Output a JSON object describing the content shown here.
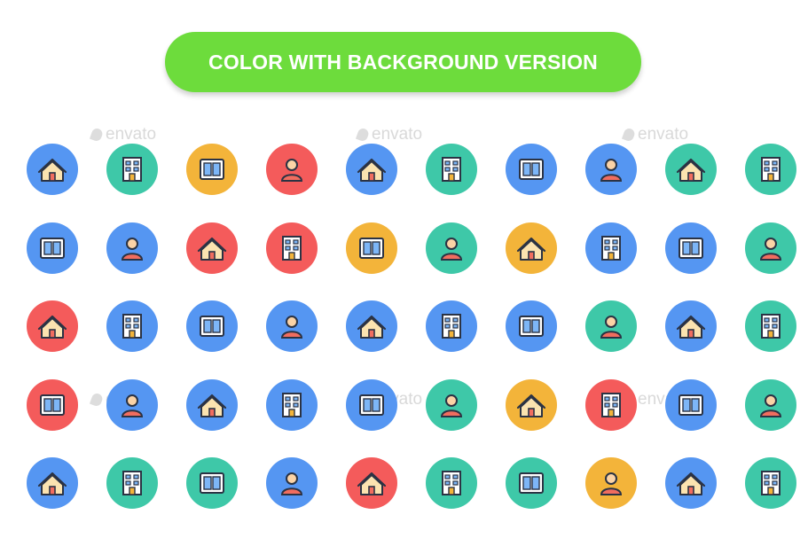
{
  "banner": {
    "text": "COLOR WITH BACKGROUND VERSION",
    "color": "#6ddc3c"
  },
  "watermark": {
    "text": "envato"
  },
  "colors": {
    "blue": "#5596f2",
    "teal": "#3ec8a8",
    "orange": "#f3b43a",
    "red": "#f45b5b"
  },
  "icons": [
    [
      {
        "name": "swimming-pool-icon",
        "bg": "blue"
      },
      {
        "name": "window-icon",
        "bg": "teal"
      },
      {
        "name": "elevator-icon",
        "bg": "orange"
      },
      {
        "name": "lift-people-icon",
        "bg": "red"
      },
      {
        "name": "apartment-building-icon",
        "bg": "blue"
      },
      {
        "name": "house-repair-icon",
        "bg": "teal"
      },
      {
        "name": "house-keys-icon",
        "bg": "blue"
      },
      {
        "name": "mosque-icon",
        "bg": "blue"
      },
      {
        "name": "real-estate-agent-icon",
        "bg": "teal"
      },
      {
        "name": "house-tools-icon",
        "bg": "teal"
      }
    ],
    [
      {
        "name": "store-icon",
        "bg": "blue"
      },
      {
        "name": "waterfront-house-icon",
        "bg": "blue"
      },
      {
        "name": "cottage-icon",
        "bg": "red"
      },
      {
        "name": "property-discount-icon",
        "bg": "red"
      },
      {
        "name": "bathtub-shower-icon",
        "bg": "orange"
      },
      {
        "name": "construction-worker-icon",
        "bg": "teal"
      },
      {
        "name": "property-contract-icon",
        "bg": "orange"
      },
      {
        "name": "bath-relax-icon",
        "bg": "blue"
      },
      {
        "name": "government-building-icon",
        "bg": "blue"
      },
      {
        "name": "skyscraper-icon",
        "bg": "teal"
      }
    ],
    [
      {
        "name": "office-tower-icon",
        "bg": "red"
      },
      {
        "name": "house-money-icon",
        "bg": "blue"
      },
      {
        "name": "villa-icon",
        "bg": "blue"
      },
      {
        "name": "robotic-arm-icon",
        "bg": "blue"
      },
      {
        "name": "city-buildings-icon",
        "bg": "blue"
      },
      {
        "name": "home-outdoor-icon",
        "bg": "blue"
      },
      {
        "name": "homeowner-icon",
        "bg": "blue"
      },
      {
        "name": "apartment-block-icon",
        "bg": "teal"
      },
      {
        "name": "hotel-icon",
        "bg": "blue"
      },
      {
        "name": "family-house-icon",
        "bg": "teal"
      }
    ],
    [
      {
        "name": "mortgage-document-icon",
        "bg": "red"
      },
      {
        "name": "house-tree-icon",
        "bg": "blue"
      },
      {
        "name": "bank-icon",
        "bg": "blue"
      },
      {
        "name": "family-home-icon",
        "bg": "blue"
      },
      {
        "name": "neighborhood-icon",
        "bg": "blue"
      },
      {
        "name": "toolbox-icon",
        "bg": "teal"
      },
      {
        "name": "resident-icon",
        "bg": "orange"
      },
      {
        "name": "house-coins-icon",
        "bg": "red"
      },
      {
        "name": "home-person-icon",
        "bg": "blue"
      },
      {
        "name": "farm-barn-icon",
        "bg": "teal"
      }
    ],
    [
      {
        "name": "suburban-house-icon",
        "bg": "blue"
      },
      {
        "name": "church-icon",
        "bg": "teal"
      },
      {
        "name": "factory-icon",
        "bg": "teal"
      },
      {
        "name": "house-heating-icon",
        "bg": "blue"
      },
      {
        "name": "online-property-icon",
        "bg": "red"
      },
      {
        "name": "wheelbarrow-icon",
        "bg": "teal"
      },
      {
        "name": "property-presentation-icon",
        "bg": "teal"
      },
      {
        "name": "property-network-icon",
        "bg": "orange"
      },
      {
        "name": "house-insurance-icon",
        "bg": "blue"
      },
      {
        "name": "love-home-icon",
        "bg": "teal"
      }
    ]
  ]
}
